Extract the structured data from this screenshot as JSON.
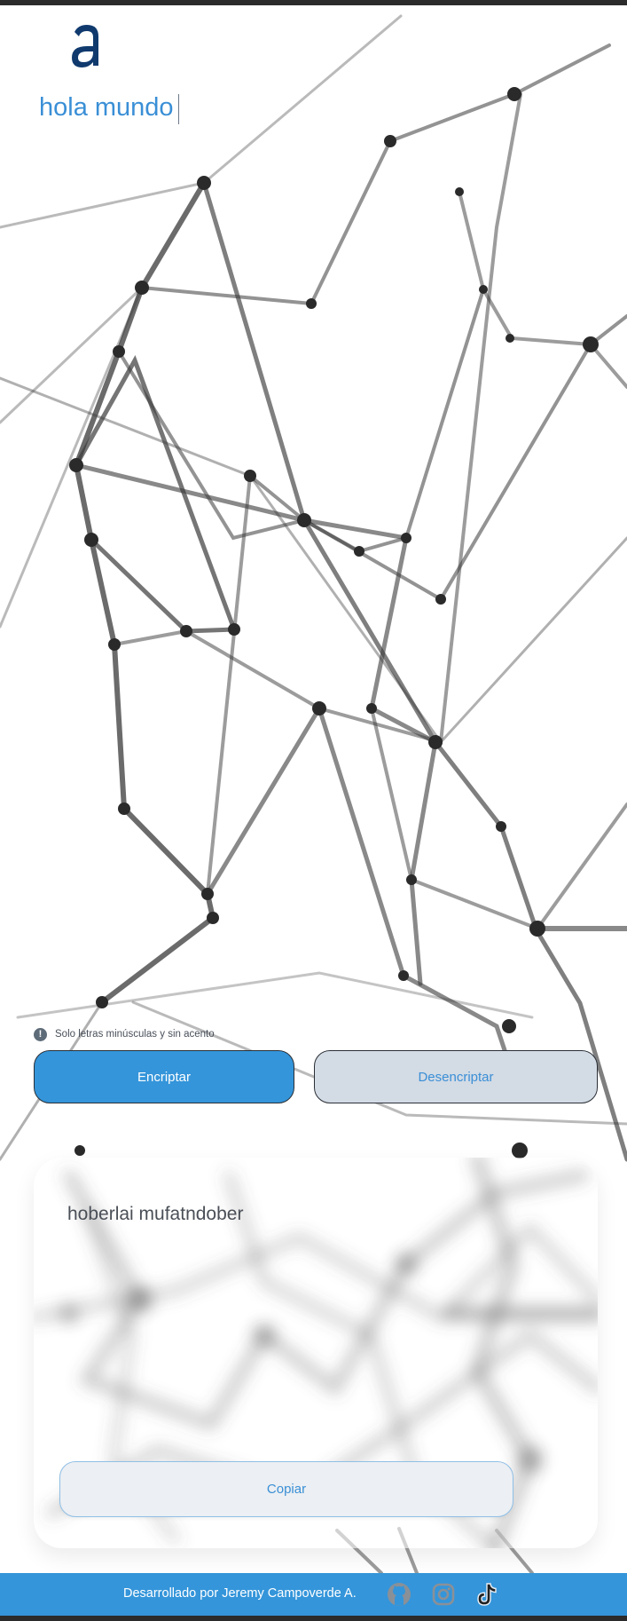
{
  "input": {
    "value": "hola mundo"
  },
  "hint": {
    "icon": "info-icon",
    "text": "Solo letras minúsculas y sin acento"
  },
  "buttons": {
    "encrypt_label": "Encriptar",
    "decrypt_label": "Desencriptar",
    "copy_label": "Copiar"
  },
  "output": {
    "text": "hoberlai mufatndober"
  },
  "footer": {
    "text": "Desarrollado por Jeremy Campoverde A.",
    "social": [
      {
        "icon": "github-icon"
      },
      {
        "icon": "instagram-icon"
      },
      {
        "icon": "tiktok-icon"
      }
    ]
  },
  "colors": {
    "accent": "#3495da",
    "text_blue": "#3a8fd6",
    "decrypt_bg": "#d3dbe5"
  }
}
